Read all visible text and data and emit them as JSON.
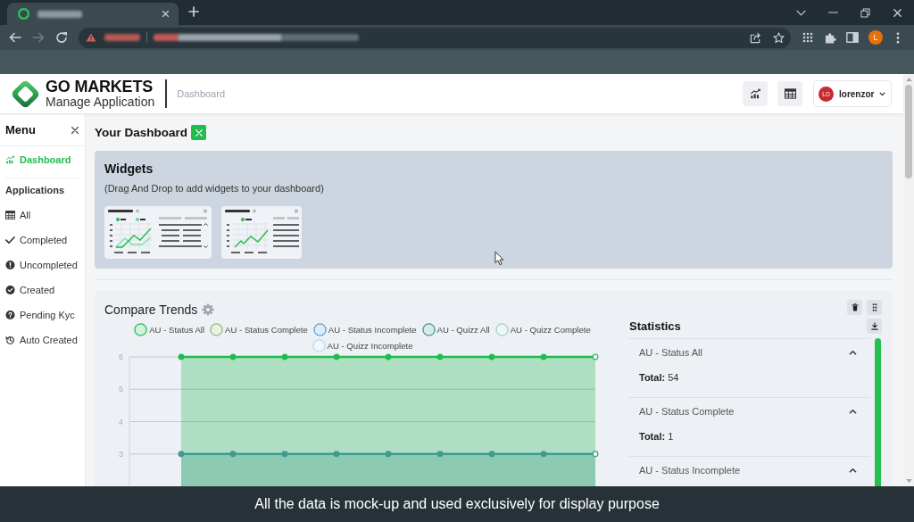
{
  "browser": {
    "forward_button": {
      "disabled": true
    },
    "profile_initial": "L"
  },
  "header": {
    "brand": "GO MARKETS",
    "subtitle": "Manage Application",
    "breadcrumb": "Dashboard",
    "user": {
      "initials": "LO",
      "name": "lorenzor"
    }
  },
  "sidebar": {
    "title": "Menu",
    "items": [
      {
        "label": "Dashboard",
        "selected": true
      }
    ],
    "sections": [
      {
        "heading": "Applications",
        "items": [
          {
            "label": "All",
            "selected": false
          },
          {
            "label": "Completed",
            "selected": false
          },
          {
            "label": "Uncompleted",
            "selected": false
          },
          {
            "label": "Created",
            "selected": false
          },
          {
            "label": "Pending Kyc",
            "selected": false
          },
          {
            "label": "Auto Created",
            "selected": false
          }
        ]
      }
    ]
  },
  "dashboard": {
    "title": "Your Dashboard",
    "widgets": {
      "title": "Widgets",
      "hint": "(Drag And Drop to add widgets to your dashboard)",
      "items": [
        {
          "kind": "dual-chart"
        },
        {
          "kind": "single-chart"
        }
      ]
    },
    "trends": {
      "title": "Compare Trends",
      "chart_data": {
        "type": "area",
        "legend": "top",
        "grid": true,
        "ylim": [
          2,
          6
        ],
        "yticks": [
          3,
          4,
          5,
          6
        ],
        "series": [
          {
            "name": "AU - Status All",
            "color": "#22bb4e",
            "values": [
              null,
              6,
              6,
              6,
              6,
              6,
              6,
              6,
              6,
              6
            ]
          },
          {
            "name": "AU - Status Complete",
            "color": "#93b97f",
            "values": [
              null,
              null,
              null,
              null,
              null,
              null,
              null,
              null,
              null,
              null
            ]
          },
          {
            "name": "AU - Status Incomplete",
            "color": "#5b9fd6",
            "values": [
              null,
              null,
              null,
              null,
              null,
              null,
              null,
              null,
              null,
              null
            ]
          },
          {
            "name": "AU - Quizz All",
            "color": "#3f9a90",
            "values": [
              null,
              3,
              3,
              3,
              3,
              3,
              3,
              3,
              3,
              3
            ]
          },
          {
            "name": "AU - Quizz Complete",
            "color": "#a2d4c6",
            "values": [
              null,
              null,
              null,
              null,
              null,
              null,
              null,
              null,
              null,
              null
            ]
          },
          {
            "name": "AU - Quizz Incomplete",
            "color": "#b4dcf3",
            "values": [
              null,
              null,
              null,
              null,
              null,
              null,
              null,
              null,
              null,
              null
            ]
          }
        ]
      }
    },
    "statistics": {
      "title": "Statistics",
      "items": [
        {
          "title": "AU - Status All",
          "expanded": true,
          "total": "**Total:** 54"
        },
        {
          "title": "AU - Status Complete",
          "expanded": true,
          "total": "**Total:** 1"
        },
        {
          "title": "AU - Status Incomplete",
          "expanded": true
        }
      ]
    }
  },
  "caption": "All the data is mock-up and used exclusively for display purpose"
}
